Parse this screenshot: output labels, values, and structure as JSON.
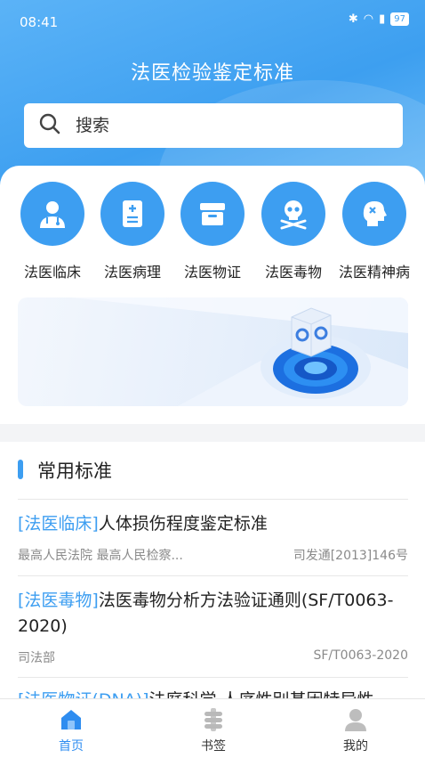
{
  "status": {
    "time": "08:41",
    "battery": "97"
  },
  "header": {
    "title": "法医检验鉴定标准"
  },
  "search": {
    "placeholder": "搜索"
  },
  "categories": [
    {
      "label": "法医临床",
      "icon": "doctor-icon"
    },
    {
      "label": "法医病理",
      "icon": "report-icon"
    },
    {
      "label": "法医物证",
      "icon": "box-icon"
    },
    {
      "label": "法医毒物",
      "icon": "skull-icon"
    },
    {
      "label": "法医精神病",
      "icon": "head-icon"
    }
  ],
  "section": {
    "title": "常用标准"
  },
  "standards": [
    {
      "tag": "[法医临床]",
      "title": "人体损伤程度鉴定标准",
      "issuer": "最高人民法院 最高人民检察...",
      "code": "司发通[2013]146号"
    },
    {
      "tag": "[法医毒物]",
      "title": "法医毒物分析方法验证通则(SF/T0063-2020)",
      "issuer": "司法部",
      "code": "SF/T0063-2020"
    },
    {
      "tag": "[法医物证(DNA)]",
      "title": "法庭科学 人序性别基因特异性",
      "issuer": "",
      "code": ""
    }
  ],
  "tabs": [
    {
      "label": "首页",
      "icon": "home-icon",
      "active": true
    },
    {
      "label": "书签",
      "icon": "bookmark-icon",
      "active": false
    },
    {
      "label": "我的",
      "icon": "user-icon",
      "active": false
    }
  ],
  "colors": {
    "primary": "#3d9ef1",
    "active_tab": "#2f8df0"
  }
}
